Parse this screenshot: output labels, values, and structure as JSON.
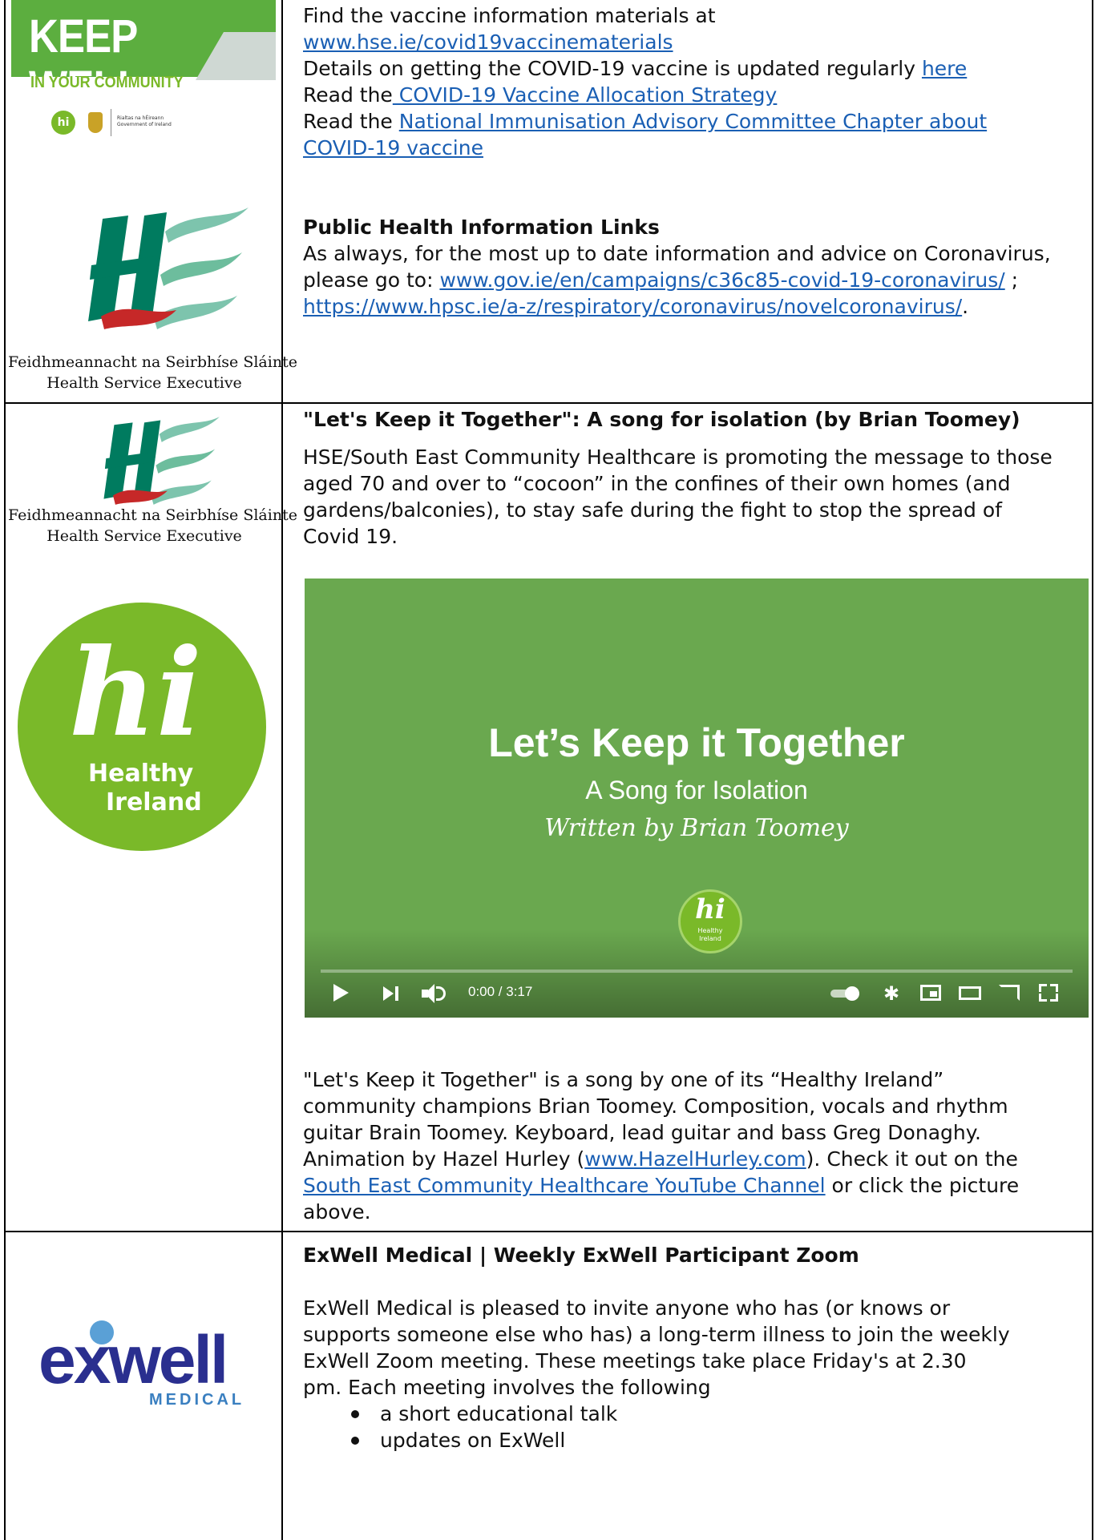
{
  "row1": {
    "keepwell_logo": {
      "title": "KEEP WELL",
      "subtitle": "IN YOUR COMMUNITY",
      "gov_small": "Rialtas na hÉireann Government of Ireland"
    },
    "hse_logo": {
      "line1": "Feidhmeannacht na Seirbhíse Sláinte",
      "line2": "Health Service Executive"
    },
    "line1": "Find the vaccine information materials at",
    "link1": "www.hse.ie/covid19vaccinematerials",
    "line3_text": "Details on getting the COVID-19 vaccine is updated regularly ",
    "line3_link": "here",
    "line4_text": "Read the",
    "line4_link": " COVID-19 Vaccine Allocation Strategy",
    "line5_text": "Read the ",
    "line5_link": "National Immunisation Advisory Committee Chapter about",
    "line6_link": "COVID-19 vaccine",
    "heading": "Public Health Information Links",
    "p1": "As always, for the most up to date information and advice on Coronavirus,",
    "p2_text": "please go to: ",
    "p2_link": "www.gov.ie/en/campaigns/c36c85-covid-19-coronavirus/",
    "p2_after": " ;",
    "p3_link": "https://www.hpsc.ie/a-z/respiratory/coronavirus/novelcoronavirus/",
    "p3_after": "."
  },
  "row2": {
    "hse_logo": {
      "line1": "Feidhmeannacht na Seirbhíse Sláinte",
      "line2": "Health Service Executive"
    },
    "hi_logo": {
      "letters": "hi",
      "line1": "Healthy",
      "line2": "Ireland"
    },
    "heading": "\"Let's Keep it Together\": A song for isolation (by Brian Toomey)",
    "intro": [
      "HSE/South East Community Healthcare is promoting the message to those",
      "aged 70 and over to “cocoon” in the confines of their own homes (and",
      "gardens/balconies), to stay safe during the fight to stop the spread of",
      "Covid 19."
    ],
    "video": {
      "title": "Let’s Keep it Together",
      "subtitle": "A Song for Isolation",
      "author": "Written by Brian Toomey",
      "badge_letters": "hi",
      "badge_line1": "Healthy",
      "badge_line2": "Ireland",
      "time": "0:00 / 3:17",
      "progress": 0,
      "bg_color": "#6aa84f"
    },
    "desc1": "\"Let's Keep it Together\" is a song by one of its “Healthy Ireland”",
    "desc2": "community champions Brian Toomey. Composition, vocals and rhythm",
    "desc3": "guitar Brain Toomey. Keyboard, lead guitar and bass Greg Donaghy.",
    "desc4_text": "Animation by Hazel Hurley (",
    "desc4_link": "www.HazelHurley.com",
    "desc4_after": "). Check it out on the",
    "desc5_link": "South East Community Healthcare YouTube Channel",
    "desc5_after": " or click the picture",
    "desc6": "above."
  },
  "row3": {
    "exwell_logo": {
      "name": "exwell",
      "sub": "MEDICAL"
    },
    "heading": "ExWell Medical | Weekly ExWell Participant Zoom",
    "body": [
      "ExWell Medical is pleased to invite anyone who has (or knows or",
      "supports someone else who has) a long-term illness to join the weekly",
      "ExWell Zoom meeting.  These meetings take place Friday's at 2.30",
      "pm.  Each meeting involves the following"
    ],
    "bullets": [
      "a short educational talk",
      "updates on ExWell"
    ]
  },
  "colors": {
    "link": "#1a5fb4",
    "hse_green": "#007b5f",
    "hse_red": "#c62828",
    "hi_green": "#7ab929",
    "keepwell_green": "#7ab929",
    "exwell_blue": "#2a2f8f"
  }
}
